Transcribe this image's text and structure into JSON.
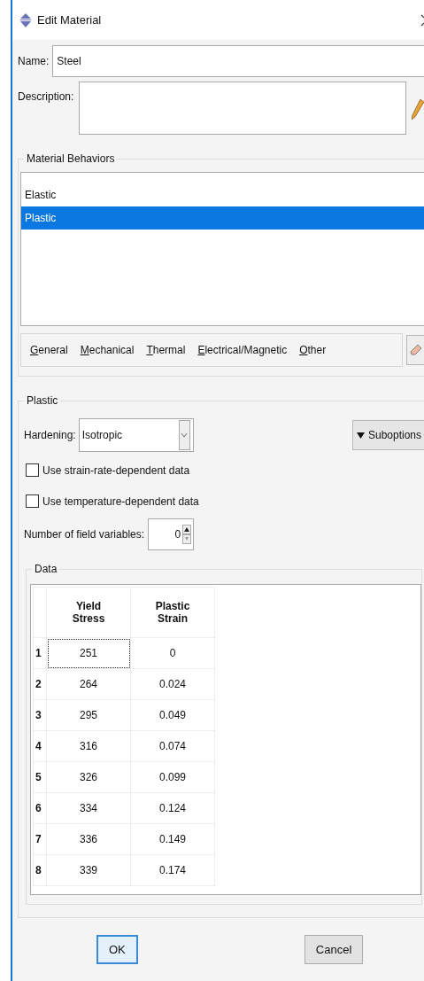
{
  "window": {
    "title": "Edit Material"
  },
  "name": {
    "label": "Name:",
    "value": "Steel"
  },
  "description": {
    "label": "Description:"
  },
  "material_behaviors": {
    "title": "Material Behaviors",
    "items": [
      {
        "label": "Elastic",
        "selected": false
      },
      {
        "label": "Plastic",
        "selected": true
      }
    ]
  },
  "menu": [
    "General",
    "Mechanical",
    "Thermal",
    "Electrical/Magnetic",
    "Other"
  ],
  "plastic": {
    "title": "Plastic",
    "hardening": {
      "label": "Hardening:",
      "value": "Isotropic"
    },
    "suboptions": "Suboptions",
    "options": [
      {
        "label": "Use strain-rate-dependent data",
        "checked": false
      },
      {
        "label": "Use temperature-dependent data",
        "checked": false
      }
    ],
    "field_variables": {
      "label": "Number of field variables:",
      "value": "0"
    }
  },
  "data": {
    "title": "Data",
    "columns": [
      "Yield Stress",
      "Plastic Strain"
    ],
    "rows": [
      {
        "number": "1",
        "cells": [
          {
            "text": "251",
            "focused": true
          },
          {
            "text": "0",
            "focused": false
          }
        ]
      },
      {
        "number": "2",
        "cells": [
          {
            "text": "264",
            "focused": false
          },
          {
            "text": "0.024",
            "focused": false
          }
        ]
      },
      {
        "number": "3",
        "cells": [
          {
            "text": "295",
            "focused": false
          },
          {
            "text": "0.049",
            "focused": false
          }
        ]
      },
      {
        "number": "4",
        "cells": [
          {
            "text": "316",
            "focused": false
          },
          {
            "text": "0.074",
            "focused": false
          }
        ]
      },
      {
        "number": "5",
        "cells": [
          {
            "text": "326",
            "focused": false
          },
          {
            "text": "0.099",
            "focused": false
          }
        ]
      },
      {
        "number": "6",
        "cells": [
          {
            "text": "334",
            "focused": false
          },
          {
            "text": "0.124",
            "focused": false
          }
        ]
      },
      {
        "number": "7",
        "cells": [
          {
            "text": "336",
            "focused": false
          },
          {
            "text": "0.149",
            "focused": false
          }
        ]
      },
      {
        "number": "8",
        "cells": [
          {
            "text": "339",
            "focused": false
          },
          {
            "text": "0.174",
            "focused": false
          }
        ]
      }
    ]
  },
  "buttons": [
    {
      "label": "OK",
      "default": true
    },
    {
      "label": "Cancel",
      "default": false
    }
  ]
}
